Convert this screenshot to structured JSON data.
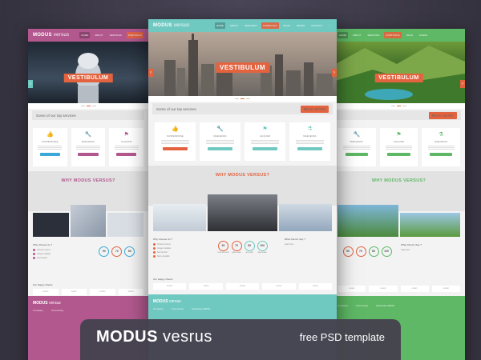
{
  "colors": {
    "pink": "#b2588e",
    "teal": "#6fc9c1",
    "green": "#5eb865",
    "orange": "#e4633f"
  },
  "template": {
    "logo_bold": "MODUS",
    "logo_light": "versus",
    "nav": [
      "HOME",
      "ABOUT",
      "SERVICES",
      "PORTFOLIO",
      "BLOG",
      "PAGES",
      "CONTACT"
    ],
    "hero_title": "VESTIBULUM",
    "services_heading": "Some of our top services",
    "read_more": "READ MORE",
    "services": [
      {
        "icon": "thumbs-up-icon",
        "glyph": "👍",
        "name": "SUSPENDISSE",
        "color": "#e4633f"
      },
      {
        "icon": "wrench-icon",
        "glyph": "🔧",
        "name": "MAECENAS",
        "color": "#e4633f"
      },
      {
        "icon": "flag-icon",
        "glyph": "⚑",
        "name": "ALIQUAM",
        "color": "#3aa9d9"
      },
      {
        "icon": "flask-icon",
        "glyph": "⚗",
        "name": "MAECENAS",
        "color": "#3aa9d9"
      }
    ],
    "why_title": "WHY MODUS VERSUS?",
    "why_col_title": "Why Choose Us ?",
    "why_items": [
      "Vivamus lectus",
      "Integer sodales",
      "Sed tempor",
      "Nam convallis",
      "Donec feugiat",
      "Mauris aliquet"
    ],
    "stats": [
      {
        "value": "90",
        "label": "SUSPENDISSE"
      },
      {
        "value": "70",
        "label": "MAECENAS"
      },
      {
        "value": "80",
        "label": "ALIQUAM"
      },
      {
        "value": "100",
        "label": "MAECENAS"
      }
    ],
    "news_title": "What Client's Say ?",
    "news_link": "read more",
    "clients_title": "Our Happy Clients",
    "client_logos": [
      "Lorem",
      "Lorem",
      "Lorem",
      "Lorem",
      "Lorem"
    ],
    "footer_cols": [
      "Company",
      "Community",
      "Subscribe NEWS"
    ]
  },
  "banner": {
    "brand_bold": "MODUS",
    "brand_light": "vesrus",
    "tagline": "free PSD template"
  }
}
